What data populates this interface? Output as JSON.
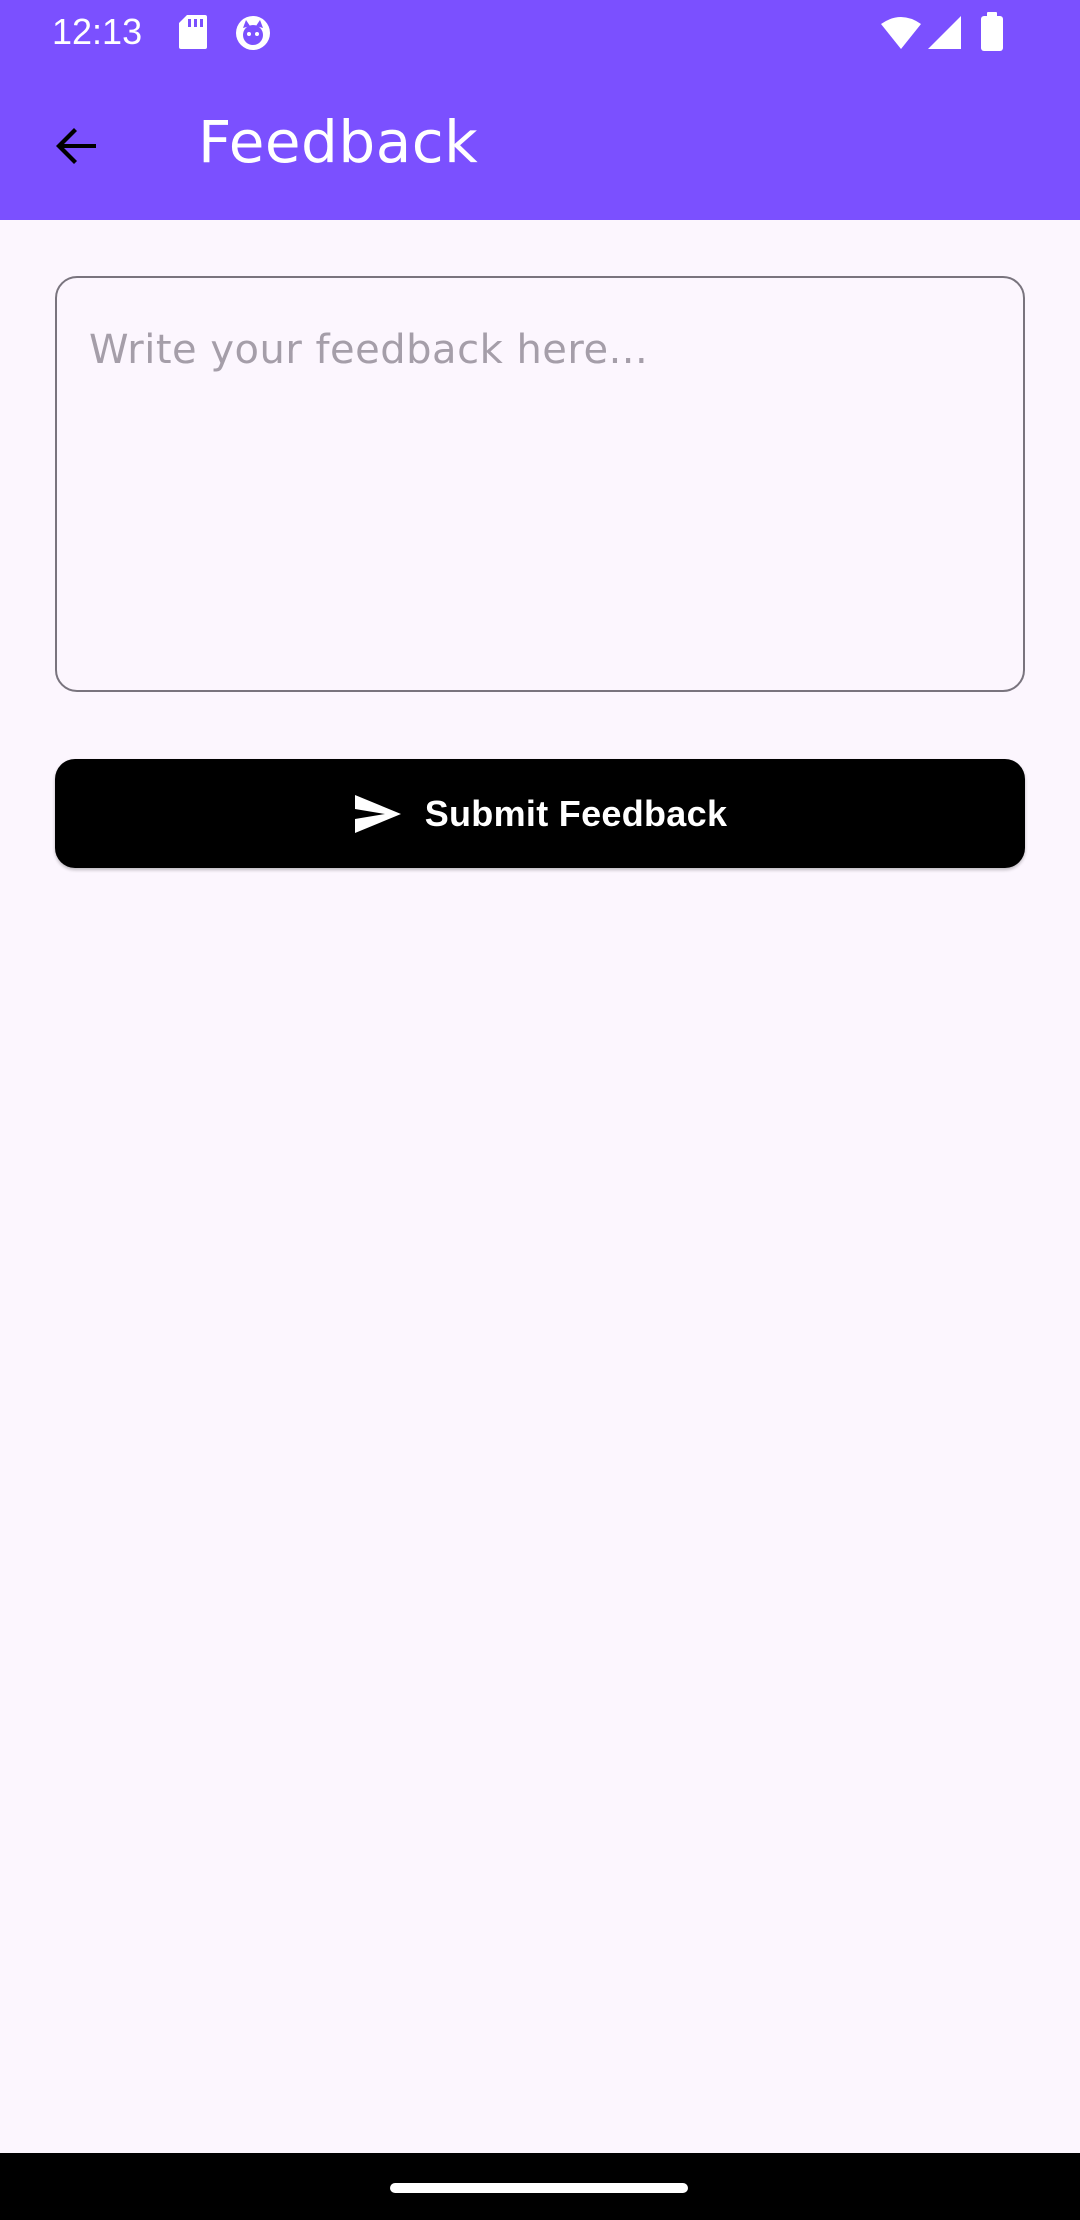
{
  "status_bar": {
    "time": "12:13",
    "left_icons": [
      "sd-card-icon",
      "cat-face-icon"
    ],
    "right_icons": [
      "wifi-icon",
      "signal-icon",
      "battery-icon"
    ]
  },
  "app_bar": {
    "back_icon": "arrow-back-icon",
    "title": "Feedback"
  },
  "feedback_form": {
    "input_value": "",
    "placeholder": "Write your feedback here...",
    "submit_icon": "send-icon",
    "submit_label": "Submit Feedback"
  },
  "colors": {
    "app_bar": "#7B50FF",
    "background": "#FCF6FE",
    "button": "#000000",
    "outline": "#79747E",
    "placeholder": "#A59EA9"
  }
}
